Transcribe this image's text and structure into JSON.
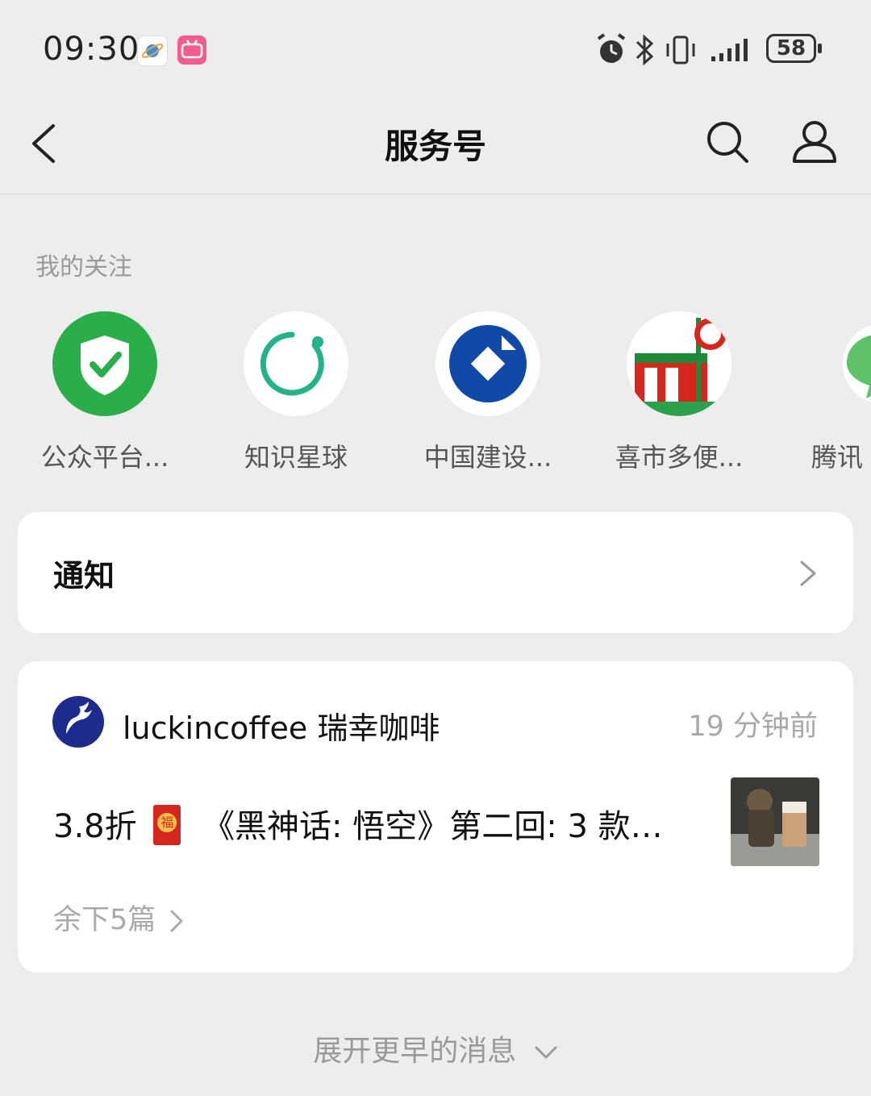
{
  "status_bar": {
    "time": "09:30",
    "battery": "58",
    "icons": [
      "planet-app-icon",
      "bilibili-icon",
      "alarm-icon",
      "bluetooth-icon",
      "vibrate-icon",
      "signal-icon",
      "battery-icon"
    ]
  },
  "nav": {
    "title": "服务号"
  },
  "following": {
    "section_title": "我的关注",
    "items": [
      {
        "name": "公众平台..."
      },
      {
        "name": "知识星球"
      },
      {
        "name": "中国建设..."
      },
      {
        "name": "喜市多便..."
      },
      {
        "name": "腾讯"
      }
    ]
  },
  "notice": {
    "label": "通知"
  },
  "message": {
    "sender": "luckincoffee 瑞幸咖啡",
    "time_ago": "19 分钟前",
    "title_prefix": "3.8折",
    "title": "《黑神话: 悟空》第二回: 3 款…",
    "more": "余下5篇",
    "hongbao_char": "福"
  },
  "expand": {
    "label": "展开更早的消息"
  },
  "colors": {
    "background": "#ededed",
    "green": "#2aae4a",
    "ccb_blue": "#1049a8",
    "luckin_blue": "#1d2c8c"
  }
}
